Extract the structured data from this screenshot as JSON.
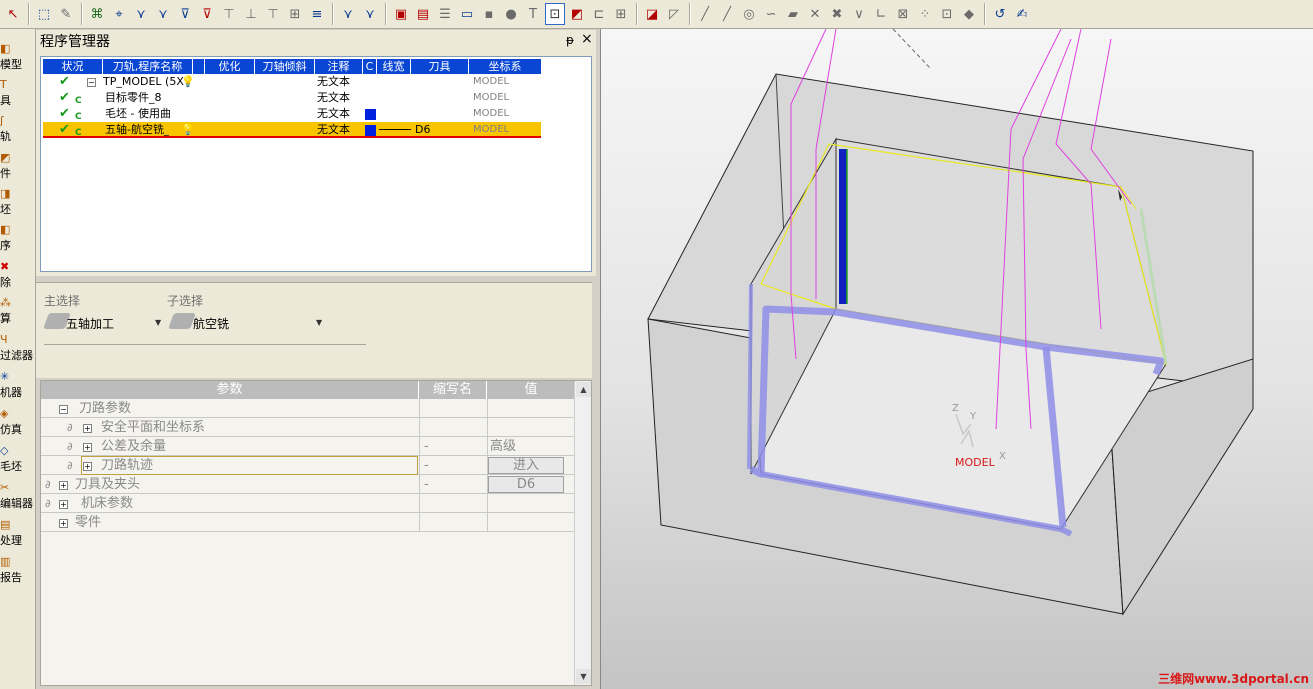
{
  "toolbar": {
    "icons": [
      "cursor-add-icon",
      "select-arrow-icon",
      "wrench-icon",
      "tool-path-1-icon",
      "tool-path-2-icon",
      "tool-path-3-icon",
      "tool-path-4-icon",
      "tool-path-5-icon",
      "tool-path-6-icon",
      "tool-path-7-icon",
      "tool-path-8-icon",
      "tool-path-9-icon",
      "tool-path-10-icon",
      "pin-icon",
      "filter-icon",
      "measure-icon",
      "calculator-icon",
      "table-icon",
      "list-icon",
      "bubble-icon",
      "circle-icon",
      "text-t-icon",
      "flow-icon",
      "box-icon",
      "grid-icon",
      "tree-icon",
      "edit-line-icon",
      "curve-icon",
      "line-icon",
      "line2-icon",
      "circle-target-icon",
      "arc-icon",
      "plane-icon",
      "cross-icon",
      "point-icon",
      "angle-icon",
      "dim-icon",
      "frame-icon",
      "xyz-icon",
      "dots-icon",
      "square-point-icon",
      "rotate-icon",
      "pen-underline-icon"
    ]
  },
  "leftbar": {
    "items": [
      {
        "label": "模型",
        "icon": "model-icon"
      },
      {
        "label": "具",
        "icon": "tool-icon"
      },
      {
        "label": "轨",
        "icon": "path-icon"
      },
      {
        "label": "件",
        "icon": "part-icon"
      },
      {
        "label": "坯",
        "icon": "stock-icon"
      },
      {
        "label": "序",
        "icon": "program-icon"
      },
      {
        "label": "除",
        "icon": "delete-icon"
      },
      {
        "label": "算",
        "icon": "calculate-icon"
      },
      {
        "label": "过滤器",
        "icon": "filter-icon"
      },
      {
        "label": "机器",
        "icon": "machine-icon"
      },
      {
        "label": "仿真",
        "icon": "simulate-icon"
      },
      {
        "label": "毛坯",
        "icon": "blank-icon"
      },
      {
        "label": "编辑器",
        "icon": "editor-icon"
      },
      {
        "label": "处理",
        "icon": "post-icon"
      },
      {
        "label": "报告",
        "icon": "report-icon"
      }
    ]
  },
  "program_manager": {
    "title": "程序管理器",
    "pin": "ᵽ",
    "close": "×",
    "columns": [
      "状况",
      "刀轨,程序名称",
      "",
      "优化",
      "刀轴倾斜",
      "注释",
      "C",
      "线宽",
      "刀具",
      "坐标系"
    ],
    "rows": [
      {
        "name": "TP_MODEL (5X",
        "comment": "无文本",
        "tool": "",
        "coord": "MODEL"
      },
      {
        "name": "目标零件_8",
        "comment": "无文本",
        "tool": "",
        "coord": "MODEL"
      },
      {
        "name": "毛坯 - 使用曲",
        "comment": "无文本",
        "tool": "",
        "coord": "MODEL"
      },
      {
        "name": "五轴-航空铣_",
        "comment": "无文本",
        "tool": "D6",
        "coord": "MODEL"
      }
    ],
    "c_mark": "C"
  },
  "selection": {
    "main_label": "主选择",
    "main_value": "五轴加工",
    "sub_label": "子选择",
    "sub_value": "航空铣"
  },
  "params": {
    "headers": [
      "参数",
      "缩写名",
      "值"
    ],
    "rows": [
      {
        "label": "刀路参数",
        "abbr": "",
        "value": ""
      },
      {
        "label": "安全平面和坐标系",
        "abbr": "",
        "value": ""
      },
      {
        "label": "公差及余量",
        "abbr": "-",
        "value": "高级"
      },
      {
        "label": "刀路轨迹",
        "abbr": "-",
        "value": "进入"
      },
      {
        "label": "刀具及夹头",
        "abbr": "-",
        "value": "D6"
      },
      {
        "label": "机床参数",
        "abbr": "",
        "value": ""
      },
      {
        "label": "零件",
        "abbr": "",
        "value": ""
      }
    ]
  },
  "viewport": {
    "axis_z": "Z",
    "axis_y": "Y",
    "axis_x": "X",
    "model_label": "MODEL",
    "watermark": "三维网www.3dportal.cn"
  },
  "colors": {
    "header_blue": "#0a46d4",
    "selected_row": "#f8c400",
    "toolpath_magenta": "#e040e0",
    "outline_yellow": "#e8e820",
    "model_label": "#d81818"
  }
}
